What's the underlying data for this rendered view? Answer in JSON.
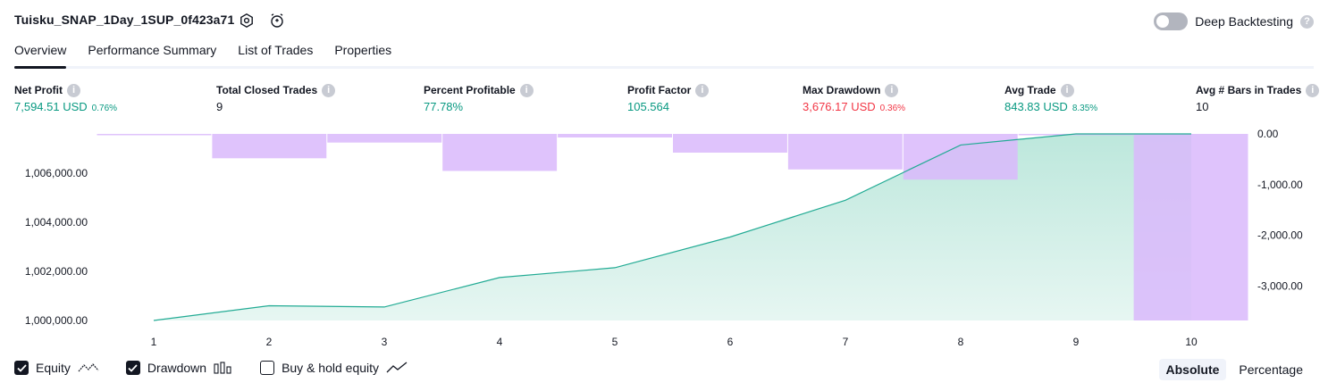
{
  "header": {
    "title": "Tuisku_SNAP_1Day_1SUP_0f423a71",
    "deep_backtesting_label": "Deep Backtesting",
    "deep_backtesting_enabled": false
  },
  "tabs": [
    {
      "label": "Overview",
      "active": true
    },
    {
      "label": "Performance Summary",
      "active": false
    },
    {
      "label": "List of Trades",
      "active": false
    },
    {
      "label": "Properties",
      "active": false
    }
  ],
  "metrics": {
    "net_profit": {
      "label": "Net Profit",
      "value": "7,594.51 USD",
      "pct": "0.76%"
    },
    "total_closed_trades": {
      "label": "Total Closed Trades",
      "value": "9"
    },
    "percent_profitable": {
      "label": "Percent Profitable",
      "value": "77.78%"
    },
    "profit_factor": {
      "label": "Profit Factor",
      "value": "105.564"
    },
    "max_drawdown": {
      "label": "Max Drawdown",
      "value": "3,676.17 USD",
      "pct": "0.36%"
    },
    "avg_trade": {
      "label": "Avg Trade",
      "value": "843.83 USD",
      "pct": "8.35%"
    },
    "avg_bars": {
      "label": "Avg # Bars in Trades",
      "value": "10"
    }
  },
  "chart_data": {
    "type": "line",
    "x": [
      1,
      2,
      3,
      4,
      5,
      6,
      7,
      8,
      9,
      10
    ],
    "series": [
      {
        "values": [
          1000000,
          1000600,
          1000550,
          1001750,
          1002150,
          1003400,
          1004900,
          1007150,
          1007600,
          1007600
        ]
      }
    ],
    "drawdown_values": [
      -10,
      -480,
      -170,
      -730,
      -70,
      -370,
      -700,
      -900,
      -25,
      -3676.17
    ],
    "left_axis": {
      "ylim": [
        1000000,
        1007600
      ],
      "ticks": [
        "1,000,000.00",
        "1,002,000.00",
        "1,004,000.00",
        "1,006,000.00"
      ]
    },
    "right_axis": {
      "ylim": [
        -3676.17,
        0
      ],
      "ticks": [
        "0.00",
        "-1,000.00",
        "-2,000.00",
        "-3,000.00"
      ]
    },
    "x_ticks": [
      "1",
      "2",
      "3",
      "4",
      "5",
      "6",
      "7",
      "8",
      "9",
      "10"
    ],
    "colors": {
      "equity_line": "#22ab94",
      "equity_fill": "#b9e6da",
      "drawdown": "#d9b8fb"
    }
  },
  "legend": {
    "equity": {
      "label": "Equity",
      "checked": true
    },
    "drawdown": {
      "label": "Drawdown",
      "checked": true
    },
    "buy_hold": {
      "label": "Buy & hold equity",
      "checked": false
    }
  },
  "view_mode": {
    "absolute": "Absolute",
    "percentage": "Percentage",
    "selected": "Absolute"
  }
}
